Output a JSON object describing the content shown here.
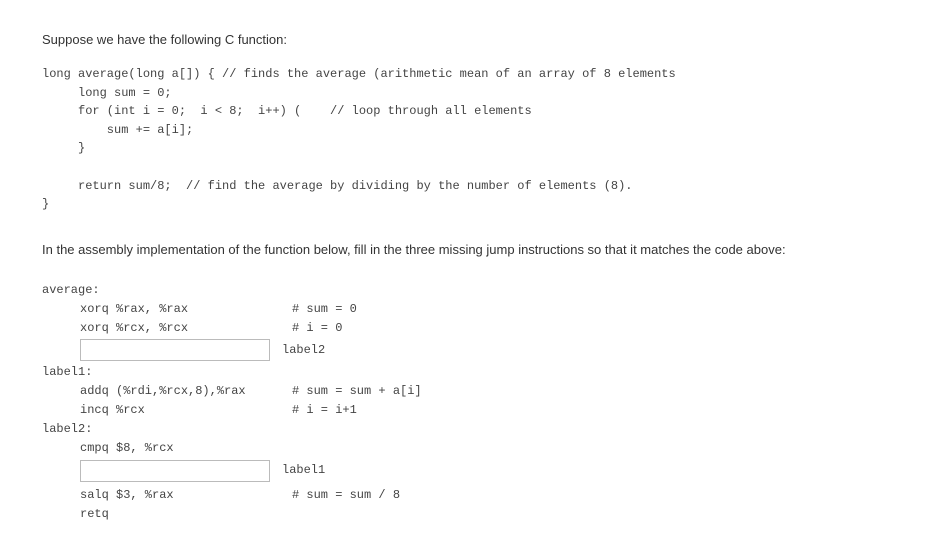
{
  "intro": "Suppose we have the following C function:",
  "c_code": "long average(long a[]) { // finds the average (arithmetic mean of an array of 8 elements\n     long sum = 0;\n     for (int i = 0;  i < 8;  i++) (    // loop through all elements\n         sum += a[i];\n     }\n\n     return sum/8;  // find the average by dividing by the number of elements (8).\n}",
  "section": "In the assembly implementation of the function below, fill in the three missing jump instructions so that it matches the code above:",
  "asm": {
    "label0": "average:",
    "line1_instr": "xorq %rax, %rax",
    "line1_comment": "# sum = 0",
    "line2_instr": "xorq %rcx, %rcx",
    "line2_comment": "# i = 0",
    "input1_after": "label2",
    "label1": "label1:",
    "line3_instr": "addq (%rdi,%rcx,8),%rax",
    "line3_comment": "# sum = sum + a[i]",
    "line4_instr": "incq %rcx",
    "line4_comment": "# i = i+1",
    "label2": "label2:",
    "line5_instr": "cmpq $8, %rcx",
    "input2_after": "label1",
    "line6_instr": "salq $3, %rax",
    "line6_comment": "# sum = sum / 8",
    "line7_instr": "retq"
  }
}
